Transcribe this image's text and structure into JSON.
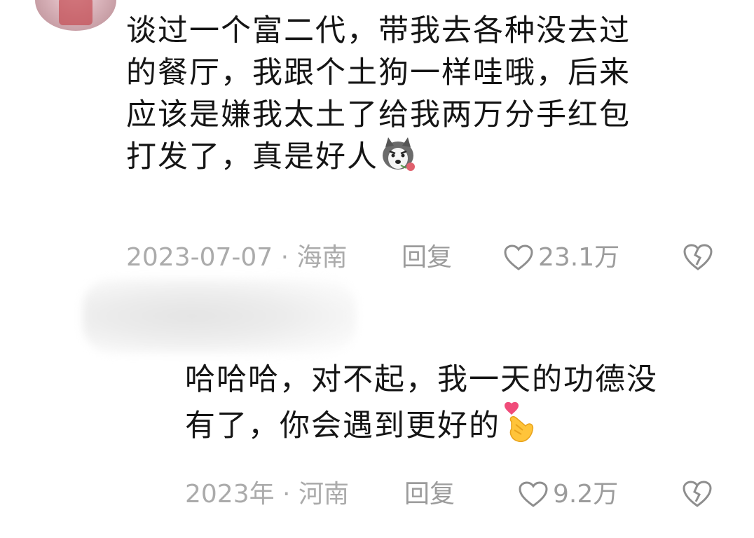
{
  "comment_1": {
    "lines": [
      "谈过一个富二代，带我去各种没去过",
      "的餐厅，我跟个土狗一样哇哦，后来",
      "应该是嫌我太土了给我两万分手红包",
      "打发了，真是好人"
    ],
    "emoji": "husky-with-rose",
    "date_location": "2023-07-07 · 海南",
    "reply_label": "回复",
    "like_count": "23.1万"
  },
  "comment_2": {
    "lines": [
      "哈哈哈，对不起，我一天的功德没",
      "有了，你会遇到更好的"
    ],
    "emoji": "finger-heart",
    "date_location": "2023年 · 河南",
    "reply_label": "回复",
    "like_count": "9.2万"
  },
  "icons": {
    "like": "heart-outline-icon",
    "dislike": "broken-heart-icon"
  },
  "colors": {
    "text": "#151515",
    "meta": "#ababab"
  }
}
